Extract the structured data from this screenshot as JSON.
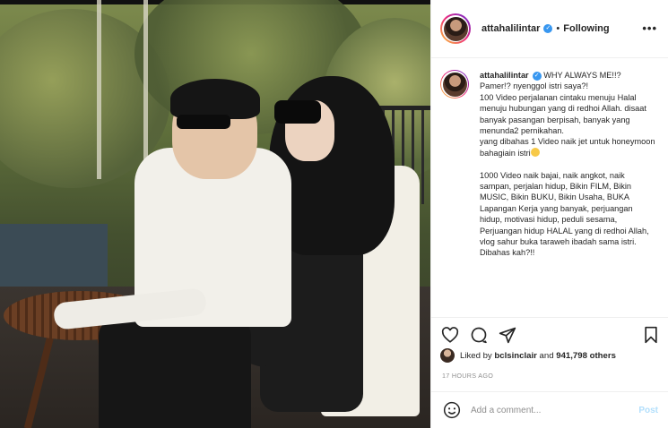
{
  "post": {
    "username": "attahalilintar",
    "follow_label": "Following",
    "dot": "•",
    "more": "•••"
  },
  "caption": {
    "username": "attahalilintar",
    "lines": [
      "WHY ALWAYS ME!!?",
      "Pamer!? nyenggol istri saya?!",
      "100 Video perjalanan cintaku menuju Halal menuju hubungan yang di redhoi Allah. disaat banyak pasangan berpisah, banyak yang menunda2 pernikahan.",
      "yang dibahas 1 Video naik jet untuk honeymoon bahagiain istri"
    ],
    "paragraph2": "1000 Video naik bajai, naik angkot, naik sampan, perjalan hidup, Bikin FILM, Bikin MUSIC, Bikin BUKU, Bikin Usaha, BUKA Lapangan Kerja yang banyak, perjuangan hidup, motivasi hidup, peduli sesama, Perjuangan hidup HALAL yang di redhoi Allah, vlog sahur buka taraweh ibadah sama istri. Dibahas kah?!!"
  },
  "likes": {
    "prefix": "Liked by",
    "user": "bclsinclair",
    "connector": "and",
    "count": "941,798 others"
  },
  "timestamp": "17 HOURS AGO",
  "comment_box": {
    "placeholder": "Add a comment...",
    "post_label": "Post"
  },
  "colors": {
    "verified": "#3897f0",
    "post_button": "#b2dffc",
    "muted": "#8e8e8e"
  },
  "icons": {
    "like": "heart-icon",
    "comment": "comment-icon",
    "share": "send-icon",
    "save": "bookmark-icon",
    "emoji": "smiley-icon",
    "verified": "verified-badge-icon"
  }
}
